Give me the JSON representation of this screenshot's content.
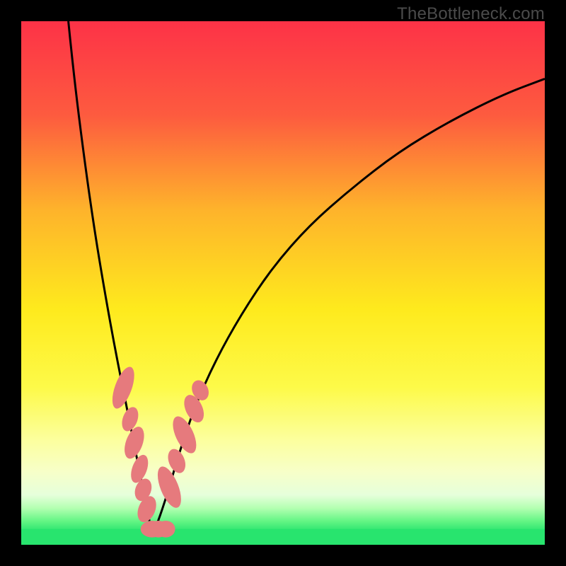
{
  "watermark": "TheBottleneck.com",
  "colors": {
    "bg": "#000000",
    "curve": "#000000",
    "marker_fill": "#e67a7d",
    "marker_stroke": "#c9585b",
    "band_green": "#28e46e",
    "gradient_stops": [
      {
        "offset": 0.0,
        "color": "#fd3247"
      },
      {
        "offset": 0.18,
        "color": "#fd5b3f"
      },
      {
        "offset": 0.36,
        "color": "#feb32b"
      },
      {
        "offset": 0.55,
        "color": "#feea1d"
      },
      {
        "offset": 0.7,
        "color": "#fdfa49"
      },
      {
        "offset": 0.8,
        "color": "#fcff9e"
      },
      {
        "offset": 0.86,
        "color": "#f7ffc8"
      },
      {
        "offset": 0.905,
        "color": "#e6ffdb"
      },
      {
        "offset": 0.93,
        "color": "#b3ffb1"
      },
      {
        "offset": 0.955,
        "color": "#63f584"
      },
      {
        "offset": 0.975,
        "color": "#28e46e"
      },
      {
        "offset": 1.0,
        "color": "#1cd867"
      }
    ]
  },
  "chart_data": {
    "type": "line",
    "title": "",
    "xlabel": "",
    "ylabel": "",
    "x_range": [
      0,
      100
    ],
    "y_range": [
      0,
      100
    ],
    "min_at_x": 25,
    "series": [
      {
        "name": "bottleneck-curve",
        "x": [
          9,
          10,
          12,
          14,
          16,
          18,
          20,
          22,
          24,
          25,
          26,
          28,
          30,
          33,
          37,
          42,
          48,
          55,
          63,
          72,
          82,
          92,
          100
        ],
        "y": [
          100,
          90,
          74,
          60,
          48,
          37,
          27,
          17,
          7,
          2,
          4,
          10,
          17,
          26,
          35,
          44,
          53,
          61,
          68,
          75,
          81,
          86,
          89
        ]
      }
    ],
    "markers": [
      {
        "x": 19.5,
        "y": 30,
        "rx": 1.6,
        "ry": 4.2,
        "rot": 20
      },
      {
        "x": 20.8,
        "y": 24,
        "rx": 1.4,
        "ry": 2.4,
        "rot": 20
      },
      {
        "x": 21.6,
        "y": 19.5,
        "rx": 1.6,
        "ry": 3.2,
        "rot": 20
      },
      {
        "x": 22.6,
        "y": 14.5,
        "rx": 1.4,
        "ry": 2.8,
        "rot": 20
      },
      {
        "x": 23.3,
        "y": 10.5,
        "rx": 1.5,
        "ry": 2.2,
        "rot": 20
      },
      {
        "x": 24.0,
        "y": 6.8,
        "rx": 1.6,
        "ry": 2.6,
        "rot": 22
      },
      {
        "x": 25.0,
        "y": 3.0,
        "rx": 2.2,
        "ry": 1.6,
        "rot": 0
      },
      {
        "x": 26.2,
        "y": 3.0,
        "rx": 1.8,
        "ry": 1.6,
        "rot": 0
      },
      {
        "x": 27.6,
        "y": 3.0,
        "rx": 1.8,
        "ry": 1.6,
        "rot": 0
      },
      {
        "x": 28.3,
        "y": 11.0,
        "rx": 1.7,
        "ry": 4.2,
        "rot": -22
      },
      {
        "x": 29.7,
        "y": 16.0,
        "rx": 1.5,
        "ry": 2.4,
        "rot": -22
      },
      {
        "x": 31.2,
        "y": 21.0,
        "rx": 1.7,
        "ry": 3.8,
        "rot": -25
      },
      {
        "x": 33.0,
        "y": 26.0,
        "rx": 1.6,
        "ry": 2.8,
        "rot": -25
      },
      {
        "x": 34.2,
        "y": 29.5,
        "rx": 1.5,
        "ry": 2.0,
        "rot": -26
      }
    ]
  }
}
